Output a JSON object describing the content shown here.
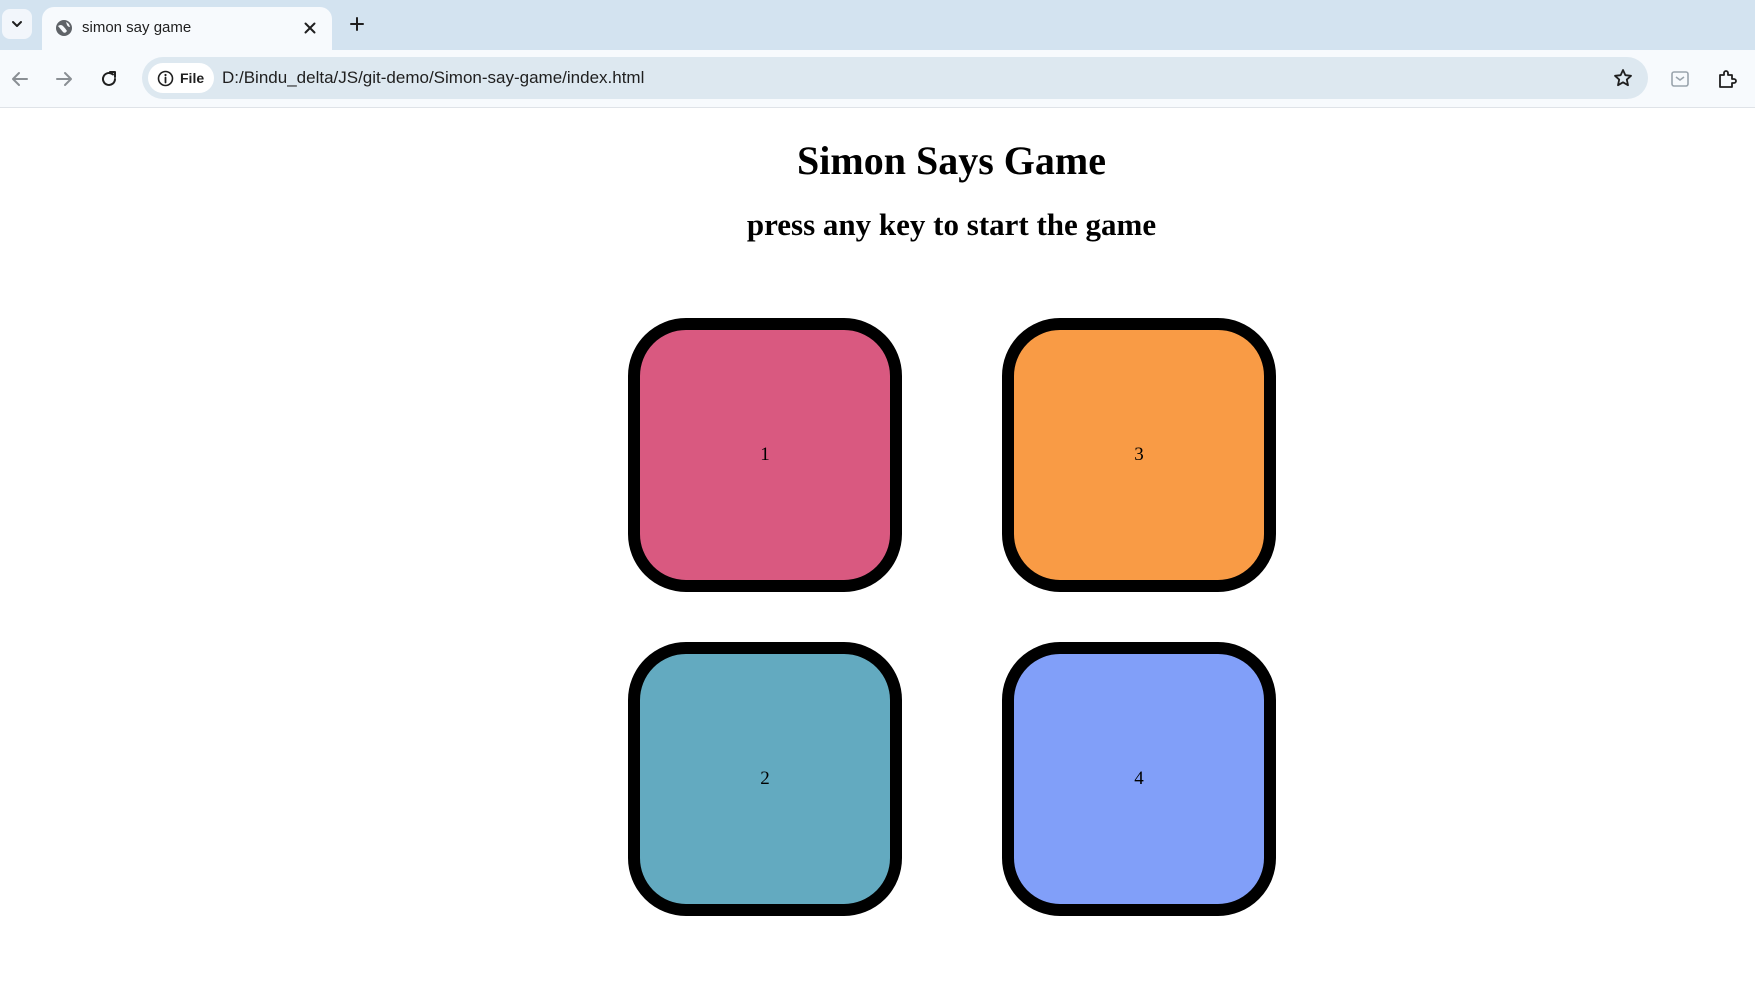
{
  "browser": {
    "tab_title": "simon say game",
    "site_chip_label": "File",
    "url": "D:/Bindu_delta/JS/git-demo/Simon-say-game/index.html",
    "icons": [
      "tab-search-icon",
      "globe-icon",
      "close-icon",
      "plus-icon",
      "back-arrow-icon",
      "forward-arrow-icon",
      "reload-icon",
      "info-icon",
      "star-icon",
      "extension-icon",
      "puzzle-icon"
    ]
  },
  "game": {
    "title": "Simon Says Game",
    "subtitle": "press any key to start the game",
    "buttons": [
      {
        "label": "1",
        "color": "#d95980"
      },
      {
        "label": "3",
        "color": "#f99b45"
      },
      {
        "label": "2",
        "color": "#63aac0"
      },
      {
        "label": "4",
        "color": "#819ff9"
      }
    ]
  }
}
